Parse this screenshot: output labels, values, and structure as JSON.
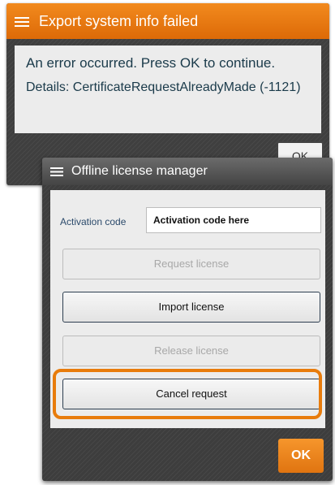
{
  "error_dialog": {
    "title": "Export system info failed",
    "message": "An error occurred. Press OK to continue.",
    "details": "Details: CertificateRequestAlreadyMade (-1121)",
    "ok_label": "OK",
    "accent_color": "#e8780e"
  },
  "license_dialog": {
    "title": "Offline license manager",
    "activation": {
      "label": "Activation code",
      "value": "Activation code here"
    },
    "buttons": {
      "request_license": "Request license",
      "import_license": "Import license",
      "release_license": "Release license",
      "cancel_request": "Cancel request"
    },
    "ok_label": "OK",
    "ok_color": "#f08a1d"
  }
}
